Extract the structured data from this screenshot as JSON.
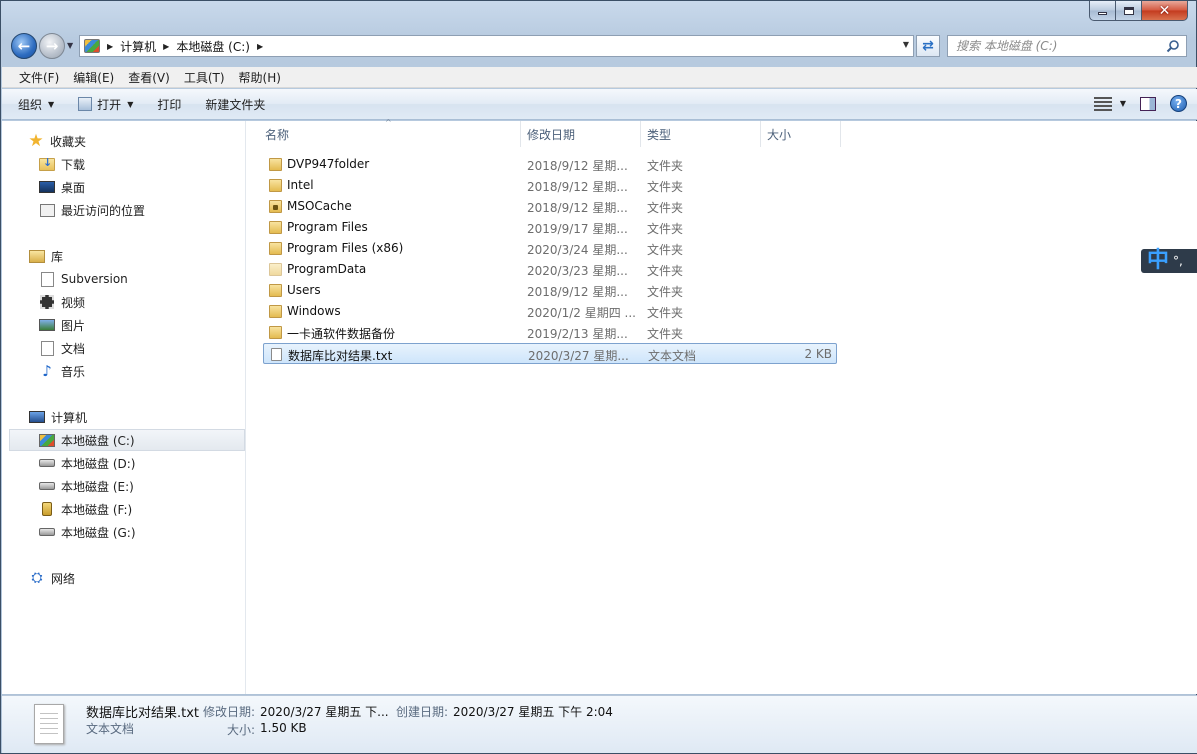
{
  "address": {
    "crumbs": [
      "计算机",
      "本地磁盘 (C:)"
    ]
  },
  "search": {
    "placeholder": "搜索 本地磁盘 (C:)"
  },
  "menu": [
    "文件(F)",
    "编辑(E)",
    "查看(V)",
    "工具(T)",
    "帮助(H)"
  ],
  "commands": {
    "organize": "组织",
    "open": "打开",
    "print": "打印",
    "new_folder": "新建文件夹"
  },
  "sidebar": {
    "favorites": {
      "label": "收藏夹",
      "items": [
        "下载",
        "桌面",
        "最近访问的位置"
      ]
    },
    "libraries": {
      "label": "库",
      "items": [
        "Subversion",
        "视频",
        "图片",
        "文档",
        "音乐"
      ]
    },
    "computer": {
      "label": "计算机",
      "items": [
        "本地磁盘 (C:)",
        "本地磁盘 (D:)",
        "本地磁盘 (E:)",
        "本地磁盘 (F:)",
        "本地磁盘 (G:)"
      ]
    },
    "network": {
      "label": "网络"
    }
  },
  "columns": {
    "name": "名称",
    "modified": "修改日期",
    "type": "类型",
    "size": "大小"
  },
  "files": [
    {
      "name": "DVP947folder",
      "date": "2018/9/12 星期...",
      "type": "文件夹",
      "size": ""
    },
    {
      "name": "Intel",
      "date": "2018/9/12 星期...",
      "type": "文件夹",
      "size": ""
    },
    {
      "name": "MSOCache",
      "date": "2018/9/12 星期...",
      "type": "文件夹",
      "size": ""
    },
    {
      "name": "Program Files",
      "date": "2019/9/17 星期...",
      "type": "文件夹",
      "size": ""
    },
    {
      "name": "Program Files (x86)",
      "date": "2020/3/24 星期...",
      "type": "文件夹",
      "size": ""
    },
    {
      "name": "ProgramData",
      "date": "2020/3/23 星期...",
      "type": "文件夹",
      "size": ""
    },
    {
      "name": "Users",
      "date": "2018/9/12 星期...",
      "type": "文件夹",
      "size": ""
    },
    {
      "name": "Windows",
      "date": "2020/1/2 星期四 ...",
      "type": "文件夹",
      "size": ""
    },
    {
      "name": "一卡通软件数据备份",
      "date": "2019/2/13 星期...",
      "type": "文件夹",
      "size": ""
    },
    {
      "name": "数据库比对结果.txt",
      "date": "2020/3/27 星期...",
      "type": "文本文档",
      "size": "2 KB"
    }
  ],
  "ime": {
    "mode": "中",
    "punct": "°,"
  },
  "details": {
    "name": "数据库比对结果.txt",
    "type": "文本文档",
    "modified_label": "修改日期:",
    "modified_value": "2020/3/27 星期五 下...",
    "created_label": "创建日期:",
    "created_value": "2020/3/27 星期五 下午 2:04",
    "size_label": "大小:",
    "size_value": "1.50 KB"
  }
}
